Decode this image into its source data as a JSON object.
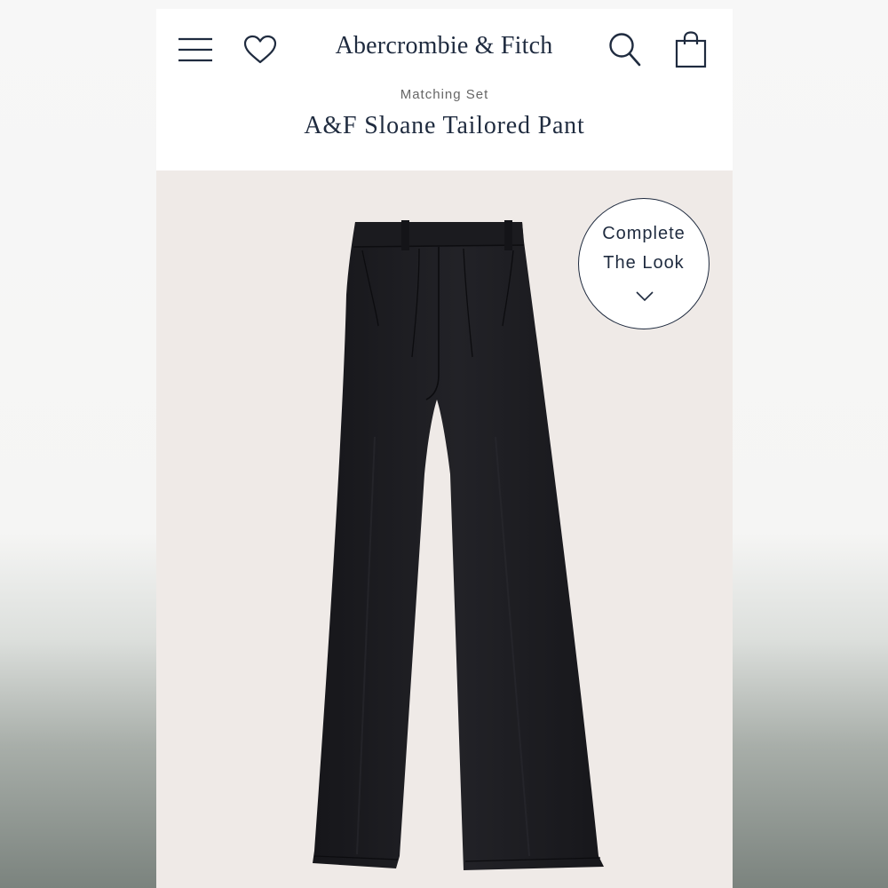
{
  "header": {
    "brand": "Abercrombie & Fitch",
    "icons": {
      "menu": "hamburger-menu-icon",
      "wishlist": "heart-icon",
      "search": "search-icon",
      "bag": "shopping-bag-icon"
    }
  },
  "product": {
    "category": "Matching Set",
    "title": "A&F Sloane Tailored Pant",
    "image_alt": "Black wide-leg pleated tailored pant",
    "color": "#1c1c20"
  },
  "complete_look": {
    "line1": "Complete",
    "line2": "The Look",
    "icon": "chevron-down-icon"
  },
  "colors": {
    "brand_navy": "#1f2b3f",
    "photo_background": "#efeae7"
  }
}
